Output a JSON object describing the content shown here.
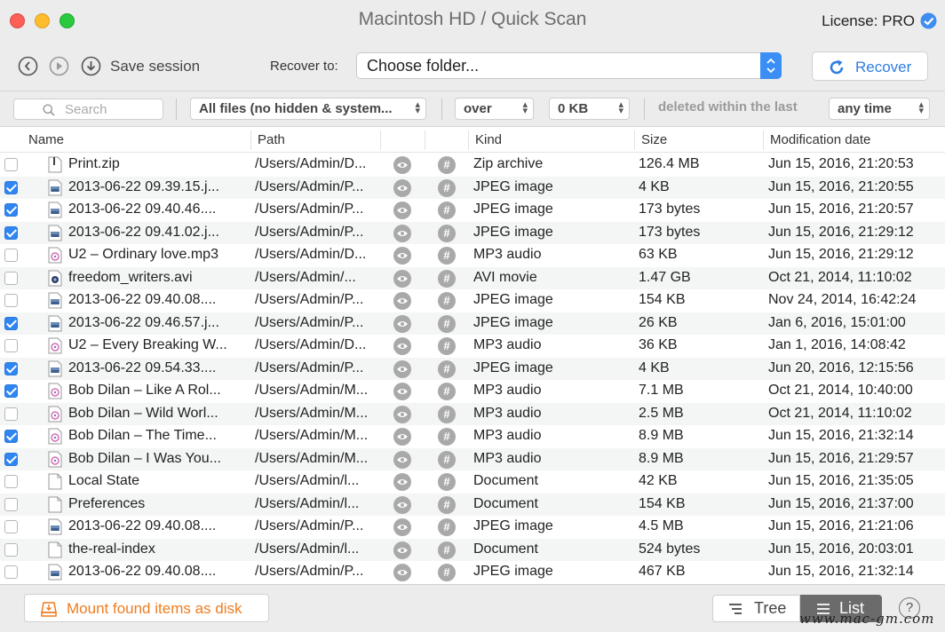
{
  "window": {
    "title": "Macintosh HD / Quick Scan",
    "license": "License: PRO"
  },
  "toolbar": {
    "save_session": "Save session",
    "recover_to_label": "Recover to:",
    "destination": "Choose folder...",
    "recover_button": "Recover"
  },
  "filters": {
    "search_placeholder": "Search",
    "file_filter": "All files (no hidden & system...",
    "size_op": "over",
    "size_value": "0 KB",
    "deleted_label": "deleted within the last",
    "time_range": "any time"
  },
  "table": {
    "columns": {
      "name": "Name",
      "path": "Path",
      "kind": "Kind",
      "size": "Size",
      "date": "Modification date"
    },
    "rows": [
      {
        "checked": false,
        "icon": "zip-file-icon",
        "name": "Print.zip",
        "path": "/Users/Admin/D...",
        "kind": "Zip archive",
        "size": "126.4 MB",
        "date": "Jun 15, 2016, 21:20:53"
      },
      {
        "checked": true,
        "icon": "image-file-icon",
        "name": "2013-06-22 09.39.15.j...",
        "path": "/Users/Admin/P...",
        "kind": "JPEG image",
        "size": "4 KB",
        "date": "Jun 15, 2016, 21:20:55"
      },
      {
        "checked": true,
        "icon": "image-file-icon",
        "name": "2013-06-22 09.40.46....",
        "path": "/Users/Admin/P...",
        "kind": "JPEG image",
        "size": "173 bytes",
        "date": "Jun 15, 2016, 21:20:57"
      },
      {
        "checked": true,
        "icon": "image-file-icon",
        "name": "2013-06-22 09.41.02.j...",
        "path": "/Users/Admin/P...",
        "kind": "JPEG image",
        "size": "173 bytes",
        "date": "Jun 15, 2016, 21:29:12"
      },
      {
        "checked": false,
        "icon": "audio-file-icon",
        "name": "U2 – Ordinary love.mp3",
        "path": "/Users/Admin/D...",
        "kind": "MP3 audio",
        "size": "63 KB",
        "date": "Jun 15, 2016, 21:29:12"
      },
      {
        "checked": false,
        "icon": "video-file-icon",
        "name": "freedom_writers.avi",
        "path": "/Users/Admin/...",
        "kind": "AVI movie",
        "size": "1.47 GB",
        "date": "Oct 21, 2014, 11:10:02"
      },
      {
        "checked": false,
        "icon": "image-file-icon",
        "name": "2013-06-22 09.40.08....",
        "path": "/Users/Admin/P...",
        "kind": "JPEG image",
        "size": "154 KB",
        "date": "Nov 24, 2014, 16:42:24"
      },
      {
        "checked": true,
        "icon": "image-file-icon",
        "name": "2013-06-22 09.46.57.j...",
        "path": "/Users/Admin/P...",
        "kind": "JPEG image",
        "size": "26 KB",
        "date": "Jan 6, 2016, 15:01:00"
      },
      {
        "checked": false,
        "icon": "audio-file-icon",
        "name": "U2 – Every Breaking W...",
        "path": "/Users/Admin/D...",
        "kind": "MP3 audio",
        "size": "36 KB",
        "date": "Jan 1, 2016, 14:08:42"
      },
      {
        "checked": true,
        "icon": "image-file-icon",
        "name": "2013-06-22 09.54.33....",
        "path": "/Users/Admin/P...",
        "kind": "JPEG image",
        "size": "4 KB",
        "date": "Jun 20, 2016, 12:15:56"
      },
      {
        "checked": true,
        "icon": "audio-file-icon",
        "name": "Bob Dilan – Like A Rol...",
        "path": "/Users/Admin/M...",
        "kind": "MP3 audio",
        "size": "7.1 MB",
        "date": "Oct 21, 2014, 10:40:00"
      },
      {
        "checked": false,
        "icon": "audio-file-icon",
        "name": "Bob Dilan – Wild Worl...",
        "path": "/Users/Admin/M...",
        "kind": "MP3 audio",
        "size": "2.5 MB",
        "date": "Oct 21, 2014, 11:10:02"
      },
      {
        "checked": true,
        "icon": "audio-file-icon",
        "name": "Bob Dilan – The Time...",
        "path": "/Users/Admin/M...",
        "kind": "MP3 audio",
        "size": "8.9 MB",
        "date": "Jun 15, 2016, 21:32:14"
      },
      {
        "checked": true,
        "icon": "audio-file-icon",
        "name": "Bob Dilan – I Was You...",
        "path": "/Users/Admin/M...",
        "kind": "MP3 audio",
        "size": "8.9 MB",
        "date": "Jun 15, 2016, 21:29:57"
      },
      {
        "checked": false,
        "icon": "document-file-icon",
        "name": "Local State",
        "path": "/Users/Admin/l...",
        "kind": "Document",
        "size": "42 KB",
        "date": "Jun 15, 2016, 21:35:05"
      },
      {
        "checked": false,
        "icon": "document-file-icon",
        "name": "Preferences",
        "path": "/Users/Admin/l...",
        "kind": "Document",
        "size": "154 KB",
        "date": "Jun 15, 2016, 21:37:00"
      },
      {
        "checked": false,
        "icon": "image-file-icon",
        "name": "2013-06-22 09.40.08....",
        "path": "/Users/Admin/P...",
        "kind": "JPEG image",
        "size": "4.5 MB",
        "date": "Jun 15, 2016, 21:21:06"
      },
      {
        "checked": false,
        "icon": "document-file-icon",
        "name": "the-real-index",
        "path": "/Users/Admin/l...",
        "kind": "Document",
        "size": "524 bytes",
        "date": "Jun 15, 2016, 20:03:01"
      },
      {
        "checked": false,
        "icon": "image-file-icon",
        "name": "2013-06-22 09.40.08....",
        "path": "/Users/Admin/P...",
        "kind": "JPEG image",
        "size": "467 KB",
        "date": "Jun 15, 2016, 21:32:14"
      }
    ]
  },
  "footer": {
    "mount_button": "Mount found items as disk",
    "view_tree": "Tree",
    "view_list": "List",
    "active_view": "List",
    "help": "?"
  },
  "watermark": "www.mac-gm.com",
  "colors": {
    "accent_blue": "#2f86f1",
    "mount_orange": "#ef7d21",
    "recover_blue": "#2f7ee0"
  }
}
